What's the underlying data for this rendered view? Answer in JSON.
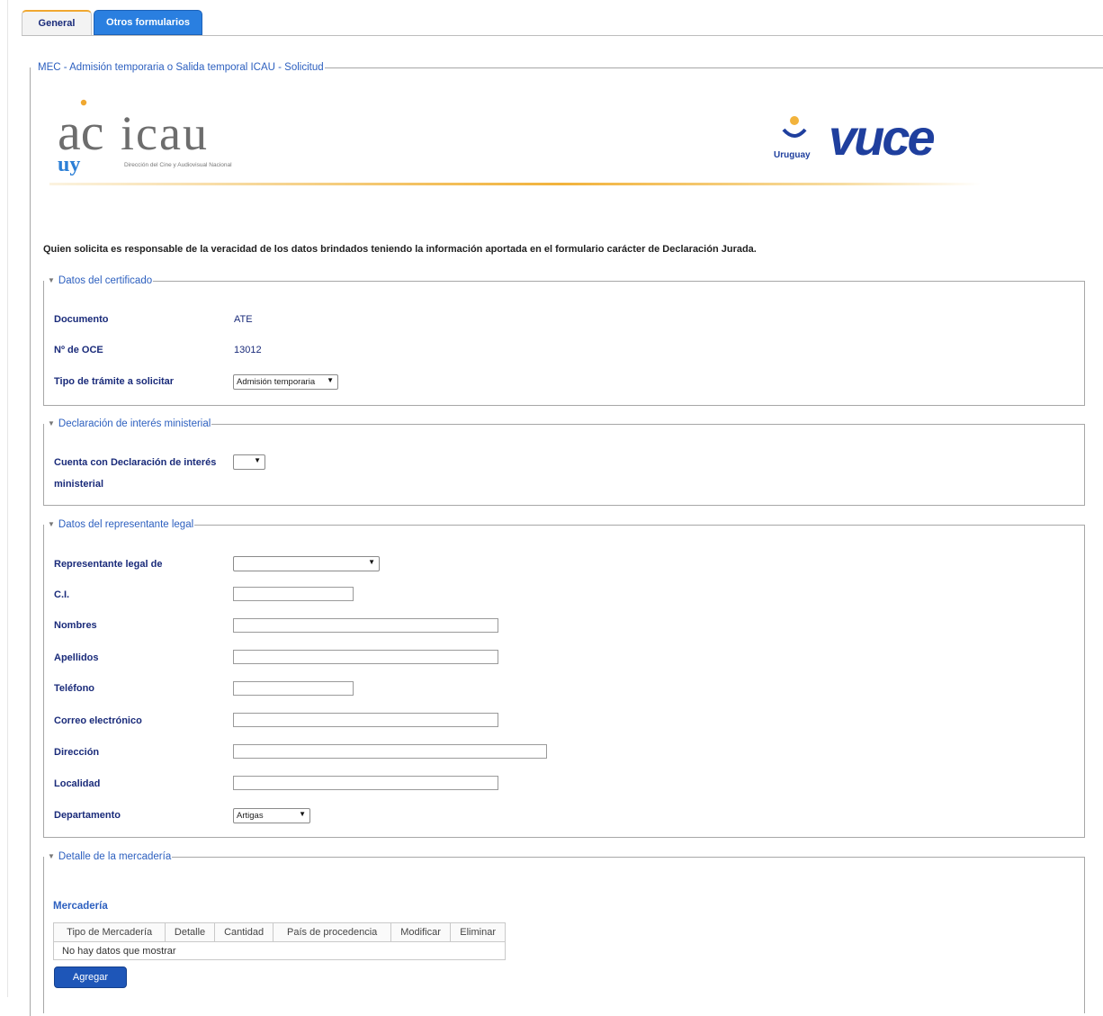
{
  "tabs": [
    {
      "label": "General",
      "active": true
    },
    {
      "label": "Otros formularios",
      "active": false
    }
  ],
  "form": {
    "legend": "MEC - Admisión temporaria o Salida temporal ICAU - Solicitud",
    "notice": "Quien solicita es responsable de la veracidad de los datos brindados teniendo la información aportada en el formulario carácter de Declaración Jurada."
  },
  "logos": {
    "icau": {
      "letters": "ac",
      "name": "icau",
      "country": "uy",
      "subtitle": "Dirección del Cine y Audiovisual Nacional"
    },
    "vuce": {
      "name": "vuce",
      "country": "Uruguay"
    }
  },
  "colors": {
    "accent": "#2a7fe0",
    "label": "#1a2b7a",
    "legend": "#2c5fbf",
    "button": "#1e56b8",
    "rule": "#f2b33c"
  },
  "certificado": {
    "legend": "Datos del certificado",
    "documento_label": "Documento",
    "documento_value": "ATE",
    "oce_label": "Nº de OCE",
    "oce_value": "13012",
    "tipo_label": "Tipo de trámite a solicitar",
    "tipo_value": "Admisión temporaria"
  },
  "declaracion": {
    "legend": "Declaración de interés ministerial",
    "cuenta_label_1": "Cuenta con Declaración de interés",
    "cuenta_label_2": "ministerial",
    "cuenta_value": ""
  },
  "representante": {
    "legend": "Datos del representante legal",
    "representante_label": "Representante legal de",
    "representante_value": "",
    "ci_label": "C.I.",
    "nombres_label": "Nombres",
    "apellidos_label": "Apellidos",
    "telefono_label": "Teléfono",
    "correo_label": "Correo electrónico",
    "direccion_label": "Dirección",
    "localidad_label": "Localidad",
    "departamento_label": "Departamento",
    "departamento_value": "Artigas"
  },
  "mercaderia": {
    "legend": "Detalle de la mercadería",
    "title": "Mercadería",
    "columns": [
      "Tipo de Mercadería",
      "Detalle",
      "Cantidad",
      "País de procedencia",
      "Modificar",
      "Eliminar"
    ],
    "empty": "No hay datos que mostrar",
    "add_label": "Agregar"
  }
}
